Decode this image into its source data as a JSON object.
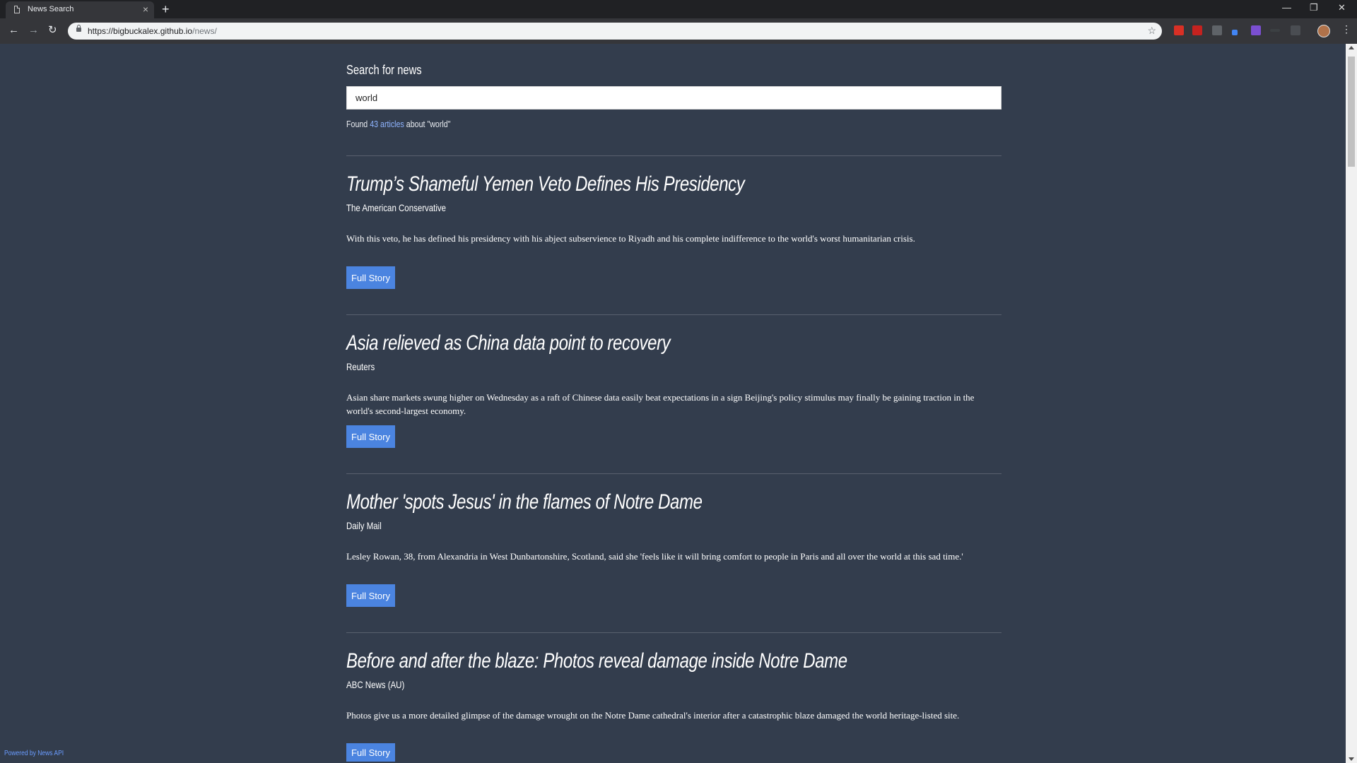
{
  "browser": {
    "tab_title": "News Search",
    "tab_close": "×",
    "new_tab": "+",
    "url_host": "https://bigbuckalex.github.io",
    "url_path": "/news/",
    "back": "←",
    "forward": "→",
    "reload": "↻",
    "star": "☆",
    "minimize": "—",
    "restore": "❐",
    "close": "✕",
    "menu": "⋮"
  },
  "search": {
    "heading": "Search for news",
    "value": "world",
    "found_prefix": "Found",
    "found_count": "43",
    "found_mid": "articles",
    "found_about": "about",
    "found_query": "\"world\""
  },
  "articles": [
    {
      "headline": "Trump’s Shameful Yemen Veto Defines His Presidency",
      "source": "The American Conservative",
      "description": "With this veto, he has defined his presidency with his abject subservience to Riyadh and his complete indifference to the world's worst humanitarian crisis.",
      "button": "Full Story"
    },
    {
      "headline": "Asia relieved as China data point to recovery",
      "source": "Reuters",
      "description": "Asian share markets swung higher on Wednesday as a raft of Chinese data easily beat expectations in a sign Beijing's policy stimulus may finally be gaining traction in the world's second-largest economy.",
      "button": "Full Story"
    },
    {
      "headline": "Mother 'spots Jesus' in the flames of Notre Dame",
      "source": "Daily Mail",
      "description": "Lesley Rowan, 38, from Alexandria in West Dunbartonshire, Scotland, said she 'feels like it will bring comfort to people in Paris and all over the world at this sad time.'",
      "button": "Full Story"
    },
    {
      "headline": "Before and after the blaze: Photos reveal damage inside Notre Dame",
      "source": "ABC News (AU)",
      "description": "Photos give us a more detailed glimpse of the damage wrought on the Notre Dame cathedral's interior after a catastrophic blaze damaged the world heritage-listed site.",
      "button": "Full Story"
    }
  ],
  "footer": {
    "powered": "Powered by News API"
  },
  "colors": {
    "page_bg": "#333d4d",
    "accent": "#4b84e0",
    "link": "#6a9cff"
  }
}
